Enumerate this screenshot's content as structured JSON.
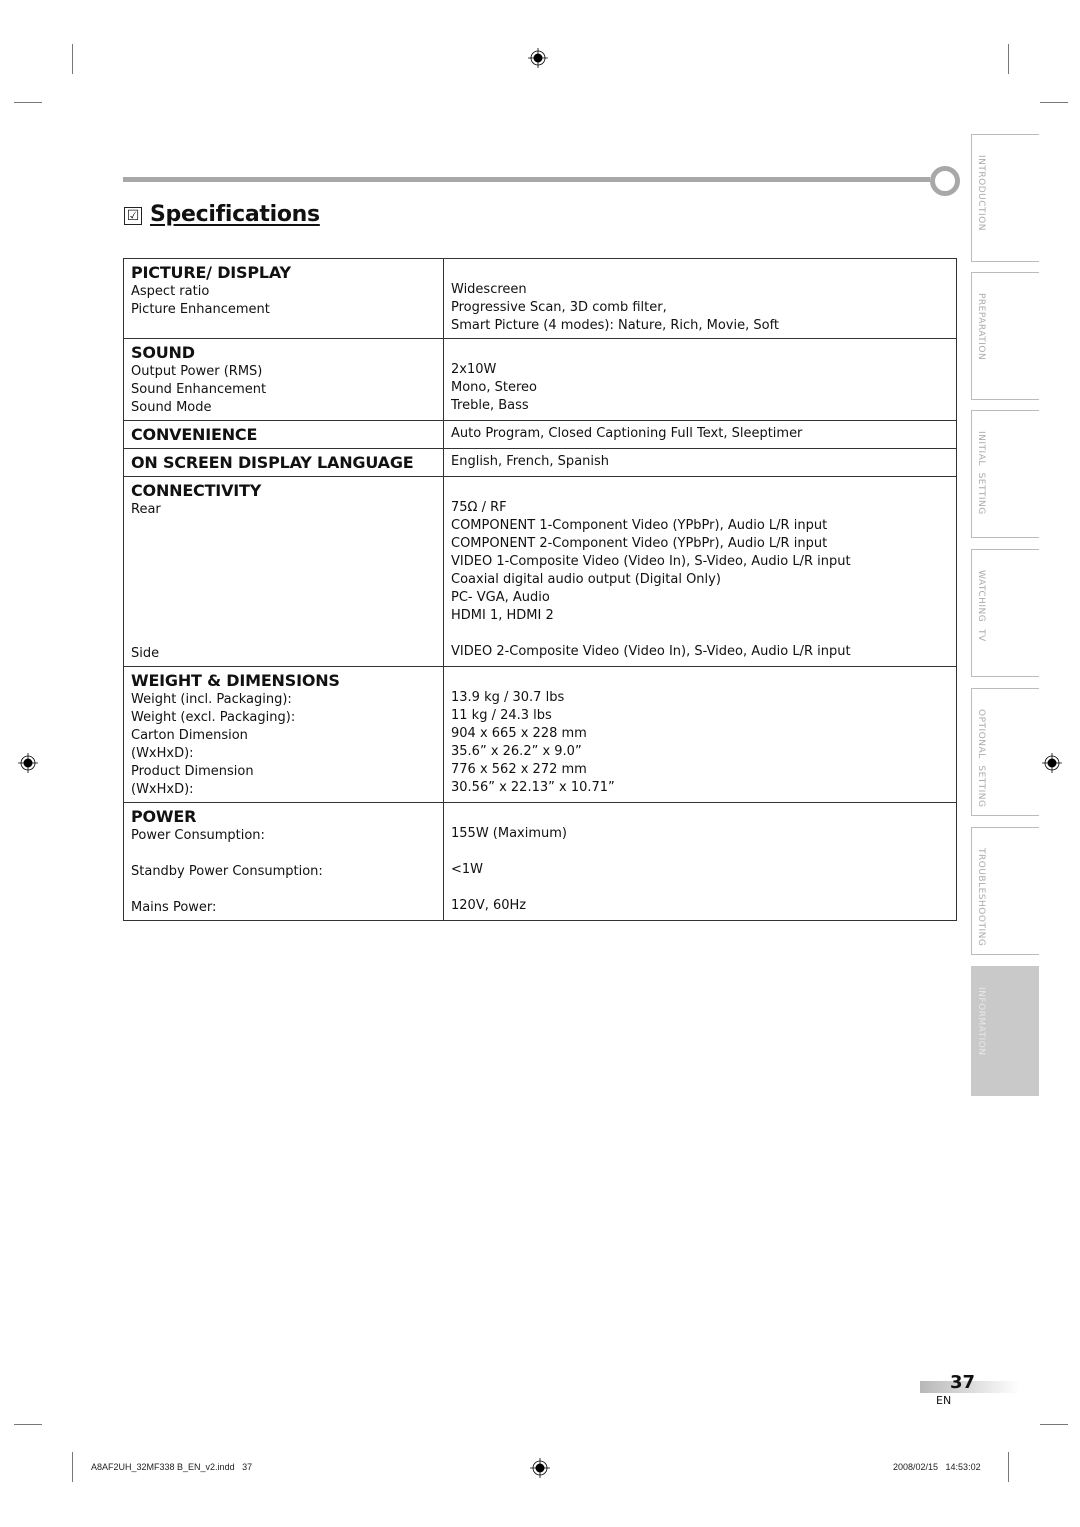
{
  "page": {
    "title": "Specifications",
    "check_symbol": "☑",
    "page_number": "37",
    "language": "EN"
  },
  "sections": [
    {
      "heading": "PICTURE/ DISPLAY",
      "rows": [
        {
          "label": "Aspect ratio",
          "value": "Widescreen"
        },
        {
          "label": "Picture Enhancement",
          "value": "Progressive Scan, 3D comb filter,"
        },
        {
          "label": "",
          "value": "Smart Picture (4 modes): Nature, Rich, Movie, Soft"
        }
      ]
    },
    {
      "heading": "SOUND",
      "rows": [
        {
          "label": "Output Power (RMS)",
          "value": "2x10W"
        },
        {
          "label": "Sound Enhancement",
          "value": "Mono, Stereo"
        },
        {
          "label": "Sound Mode",
          "value": "Treble, Bass"
        }
      ]
    },
    {
      "heading": "CONVENIENCE",
      "inline_value": "Auto Program, Closed Captioning Full Text, Sleeptimer"
    },
    {
      "heading": "ON SCREEN DISPLAY LANGUAGE",
      "inline_value": "English, French, Spanish"
    },
    {
      "heading": "CONNECTIVITY",
      "rear_label": "Rear",
      "rear_values": [
        "75Ω / RF",
        "COMPONENT 1-Component Video (YPbPr), Audio L/R input",
        "COMPONENT 2-Component Video (YPbPr), Audio L/R input",
        "VIDEO 1-Composite Video (Video In), S-Video, Audio L/R input",
        "Coaxial digital audio output (Digital Only)",
        "PC- VGA, Audio",
        "HDMI 1, HDMI 2"
      ],
      "side_label": "Side",
      "side_value": "VIDEO 2-Composite Video (Video In), S-Video, Audio L/R input"
    },
    {
      "heading": "WEIGHT & DIMENSIONS",
      "rows": [
        {
          "label": "Weight (incl. Packaging):",
          "value": "13.9 kg / 30.7 lbs"
        },
        {
          "label": "Weight (excl. Packaging):",
          "value": "11 kg / 24.3 lbs"
        },
        {
          "label": "Carton Dimension",
          "value": "904 x 665 x 228 mm"
        },
        {
          "label": "(WxHxD):",
          "value": "35.6” x 26.2” x 9.0”"
        },
        {
          "label": "Product Dimension",
          "value": "776 x 562 x 272 mm"
        },
        {
          "label": "(WxHxD):",
          "value": "30.56” x 22.13” x 10.71”"
        }
      ]
    },
    {
      "heading": "POWER",
      "rows": [
        {
          "label": "Power Consumption:",
          "value": "155W (Maximum)"
        },
        {
          "label": "Standby Power Consumption:",
          "value": "<1W"
        },
        {
          "label": "Mains Power:",
          "value": "120V, 60Hz"
        }
      ]
    }
  ],
  "side_tabs": [
    {
      "label": "INTRODUCTION",
      "active": false
    },
    {
      "label": "PREPARATION",
      "active": false
    },
    {
      "label": "INITIAL  SETTING",
      "active": false
    },
    {
      "label": "WATCHING  TV",
      "active": false
    },
    {
      "label": "OPTIONAL  SETTING",
      "active": false
    },
    {
      "label": "TROUBLESHOOTING",
      "active": false
    },
    {
      "label": "INFORMATION",
      "active": true
    }
  ],
  "footer": {
    "file_info": "A8AF2UH_32MF338 B_EN_v2.indd   37",
    "timestamp": "2008/02/15   14:53:02"
  },
  "colors": {
    "rule": "#a8a8a8",
    "active_tab": "#c9c9c9",
    "tab_text": "#aaaaaa",
    "border": "#333333"
  }
}
